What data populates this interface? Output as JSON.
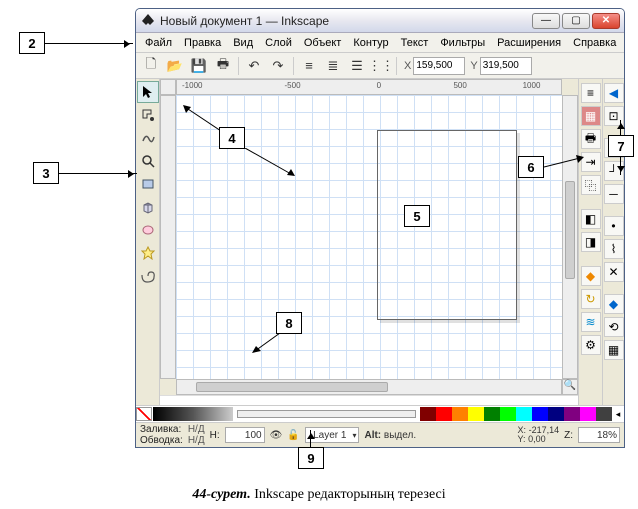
{
  "window": {
    "title": "Новый документ 1 — Inkscape"
  },
  "menu": {
    "file": "Файл",
    "edit": "Правка",
    "view": "Вид",
    "layer": "Слой",
    "object": "Объект",
    "path": "Контур",
    "text": "Текст",
    "filters": "Фильтры",
    "extensions": "Расширения",
    "help": "Справка"
  },
  "coords": {
    "x_label": "X",
    "x_value": "159,500",
    "y_label": "Y",
    "y_value": "319,500"
  },
  "ruler": {
    "m1000": "-1000",
    "m500": "-500",
    "z": "0",
    "p500": "500",
    "p1000": "1000"
  },
  "palette_colors": [
    "#800000",
    "#ff0000",
    "#ff8000",
    "#ffff00",
    "#008000",
    "#00ff00",
    "#00ffff",
    "#0000ff",
    "#000080",
    "#800080",
    "#ff00ff",
    "#404040"
  ],
  "status": {
    "fill_label": "Заливка:",
    "fill_value": "Н/Д",
    "stroke_label": "Обводка:",
    "stroke_value": "Н/Д",
    "h_label": "H:",
    "h_value": "100",
    "layer_prefix": "-",
    "layer_name": "Layer 1",
    "hint_prefix": "Alt:",
    "hint": "выдел.",
    "x_label": "X:",
    "x_val": "-217,14",
    "y_label": "Y:",
    "y_val": "0,00",
    "z_label": "Z:",
    "zoom": "18%"
  },
  "callouts": {
    "2": "2",
    "3": "3",
    "4": "4",
    "5": "5",
    "6": "6",
    "7": "7",
    "8": "8",
    "9": "9"
  },
  "caption": {
    "figure": "44-сурет.",
    "text": " Inkscape редакторының терезесі"
  }
}
